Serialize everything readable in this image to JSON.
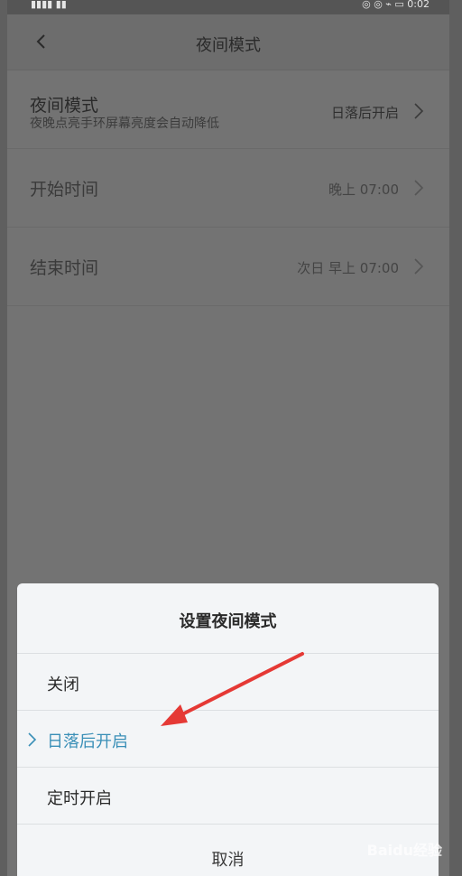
{
  "statusbar": {
    "left": "▮▮▮▮ ▮▮",
    "right": "◎ ◎ ⌁ ▭ 0:02"
  },
  "header": {
    "title": "夜间模式"
  },
  "settings": [
    {
      "label": "夜间模式",
      "sub": "夜晚点亮手环屏幕亮度会自动降低",
      "value": "日落后开启"
    },
    {
      "label": "开始时间",
      "value": "晚上 07:00"
    },
    {
      "label": "结束时间",
      "value": "次日 早上 07:00"
    }
  ],
  "dialog": {
    "title": "设置夜间模式",
    "options": [
      {
        "label": "关闭",
        "selected": false
      },
      {
        "label": "日落后开启",
        "selected": true
      },
      {
        "label": "定时开启",
        "selected": false
      }
    ],
    "cancel": "取消"
  },
  "watermark": "Baidu经验",
  "colors": {
    "accent": "#3a8fb7",
    "arrow": "#e53935"
  }
}
